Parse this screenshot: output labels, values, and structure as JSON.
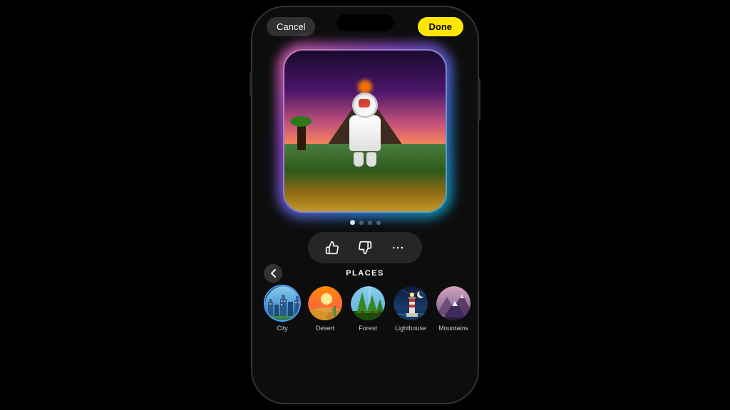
{
  "phone": {
    "topBar": {
      "cancelLabel": "Cancel",
      "doneLabel": "Done"
    },
    "pagination": {
      "dots": [
        true,
        false,
        false,
        false
      ],
      "activeIndex": 0
    },
    "actionBar": {
      "thumbsUp": "👍",
      "thumbsDown": "👎",
      "more": "···"
    },
    "places": {
      "title": "PLACES",
      "backIcon": "‹",
      "items": [
        {
          "id": "city",
          "label": "City",
          "selected": true
        },
        {
          "id": "desert",
          "label": "Desert",
          "selected": false
        },
        {
          "id": "forest",
          "label": "Forest",
          "selected": false
        },
        {
          "id": "lighthouse",
          "label": "Lighthouse",
          "selected": false
        },
        {
          "id": "mountains",
          "label": "Mountains",
          "selected": false
        }
      ]
    }
  }
}
